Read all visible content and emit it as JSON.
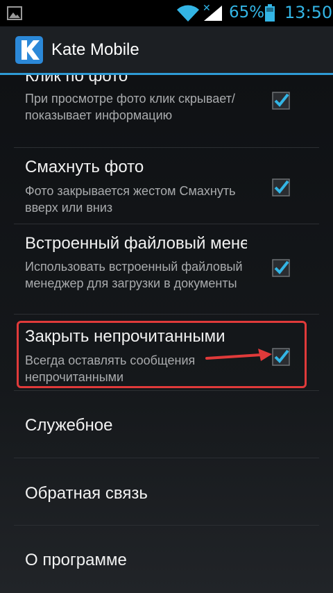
{
  "status_bar": {
    "battery_percent": "65%",
    "time": "13:50"
  },
  "action_bar": {
    "app_title": "Kate Mobile"
  },
  "settings": [
    {
      "title": "Клик по фото",
      "summary": "При просмотре фото клик скрывает/показывает информацию",
      "checked": true
    },
    {
      "title": "Смахнуть фото",
      "summary": "Фото закрывается жестом Смахнуть вверх или вниз",
      "checked": true
    },
    {
      "title": "Встроенный файловый менеджер",
      "summary": "Использовать встроенный файловый менеджер для загрузки в документы",
      "checked": true
    },
    {
      "title": "Закрыть непрочитанными",
      "summary": "Всегда оставлять сообщения непрочитанными",
      "checked": true
    }
  ],
  "sections": [
    {
      "label": "Служебное"
    },
    {
      "label": "Обратная связь"
    },
    {
      "label": "О программе"
    }
  ],
  "colors": {
    "accent": "#33b5e5",
    "highlight": "#e03a3a",
    "logo": "#2b88d8"
  }
}
